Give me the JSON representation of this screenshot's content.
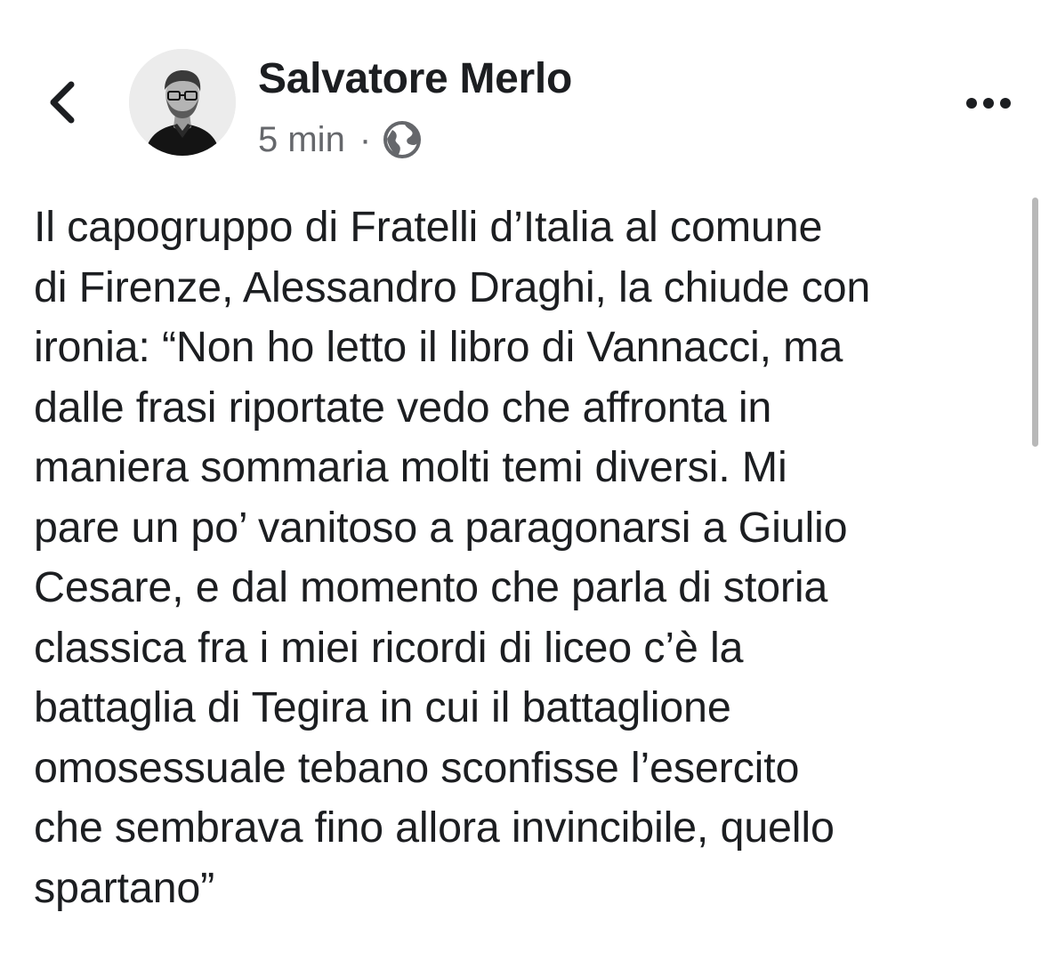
{
  "post": {
    "author": "Salvatore Merlo",
    "time": "5 min",
    "separator": "·",
    "audience_icon": "globe-icon",
    "text": "Il capogruppo di Fratelli d’Italia al comune\ndi Firenze, Alessandro Draghi, la chiude con\nironia: “Non ho letto il libro di Vannacci, ma\ndalle frasi riportate vedo che affronta in\nmaniera sommaria molti temi diversi. Mi\npare un po’ vanitoso a paragonarsi a Giulio\nCesare, e dal momento che parla di storia\nclassica fra i miei ricordi di liceo c’è la\nbattaglia di Tegira in cui il battaglione\nomosessuale tebano sconfisse l’esercito\nche sembrava fino allora invincibile, quello\nspartano”"
  },
  "icons": {
    "back": "chevron-left-icon",
    "more": "more-horizontal-icon"
  },
  "colors": {
    "text_primary": "#1c1e21",
    "text_secondary": "#65676b",
    "background": "#ffffff"
  }
}
